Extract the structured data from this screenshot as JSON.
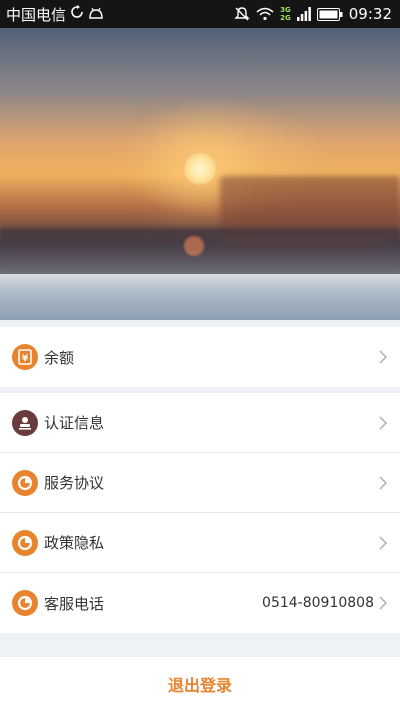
{
  "status_bar": {
    "carrier": "中国电信",
    "net_top": "3G",
    "net_bottom": "2G",
    "time": "09:32"
  },
  "balance_group": {
    "items": [
      {
        "label": "余额",
        "icon": "wallet-icon"
      }
    ]
  },
  "info_group": {
    "items": [
      {
        "label": "认证信息",
        "icon": "id-stamp-icon"
      },
      {
        "label": "服务协议",
        "icon": "pie-clock-icon"
      },
      {
        "label": "政策隐私",
        "icon": "pie-clock-icon"
      },
      {
        "label": "客服电话",
        "value": "0514-80910808",
        "icon": "pie-clock-icon"
      }
    ]
  },
  "logout": {
    "label": "退出登录"
  },
  "colors": {
    "accent": "#e8842e",
    "icon_dark": "#6a3b3b",
    "background": "#eef1f5",
    "text": "#333333",
    "chevron": "#b5b5b5"
  }
}
